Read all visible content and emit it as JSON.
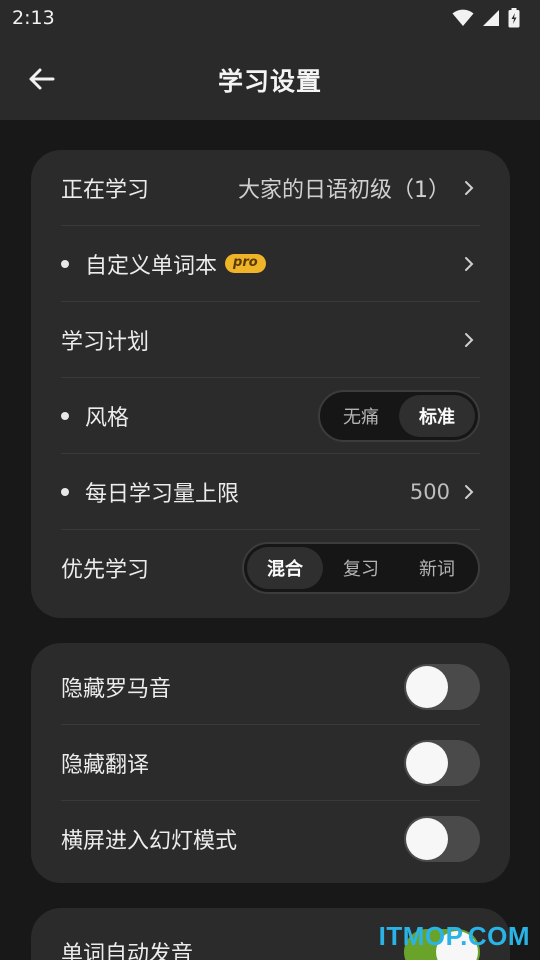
{
  "status": {
    "time": "2:13"
  },
  "appbar": {
    "title": "学习设置",
    "back_icon": "arrow-left-icon"
  },
  "card1": {
    "studying": {
      "label": "正在学习",
      "value": "大家的日语初级（1）"
    },
    "custom_wordbook": {
      "label": "自定义单词本",
      "badge": "pro"
    },
    "plan": {
      "label": "学习计划"
    },
    "style": {
      "label": "风格",
      "options": [
        "无痛",
        "标准"
      ],
      "selected": "标准"
    },
    "daily_limit": {
      "label": "每日学习量上限",
      "value": "500"
    },
    "priority": {
      "label": "优先学习",
      "options": [
        "混合",
        "复习",
        "新词"
      ],
      "selected": "混合"
    }
  },
  "card2": {
    "hide_romaji": {
      "label": "隐藏罗马音",
      "on": false
    },
    "hide_translation": {
      "label": "隐藏翻译",
      "on": false
    },
    "landscape_slides": {
      "label": "横屏进入幻灯模式",
      "on": false
    }
  },
  "card3": {
    "auto_pronounce": {
      "label": "单词自动发音",
      "on": true
    }
  },
  "watermark": {
    "text": "ITMOP.COM"
  },
  "colors": {
    "accent_green": "#6aa32a",
    "pro_badge": "#f0b429",
    "background": "#181818",
    "card": "#2b2b2b"
  }
}
